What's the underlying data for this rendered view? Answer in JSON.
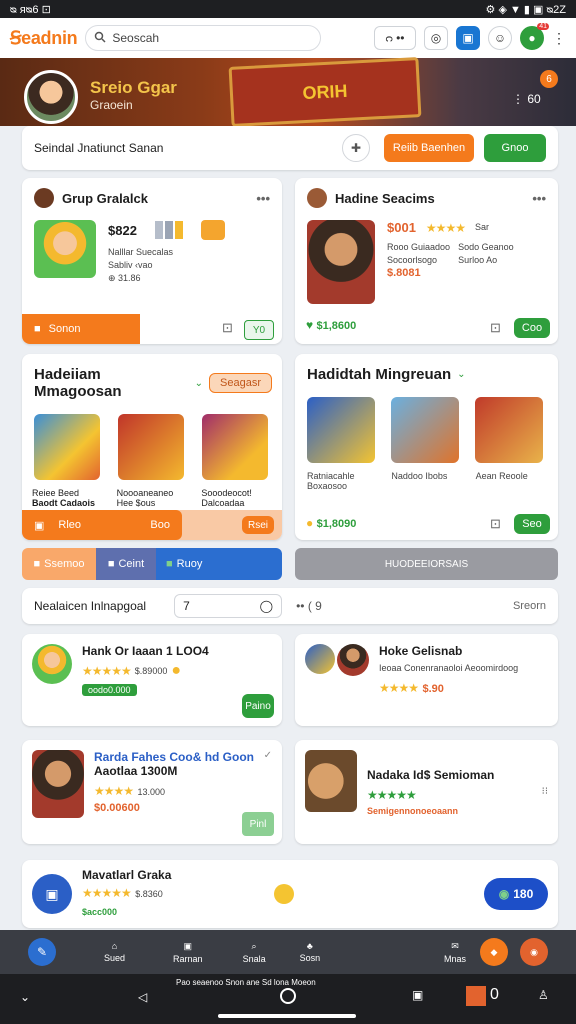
{
  "status": {
    "left": "ᴓ ᴙᴓ6 ⊡",
    "right": "⚙ ◈ ▼ ▮ ▣ ᴓ2Z"
  },
  "appbar": {
    "brand": "Ꞩeadnin",
    "search_placeholder": "Seoscah",
    "icons": [
      "ᴒ ••",
      "◎",
      "▣",
      "☺",
      "●"
    ],
    "badge": "41"
  },
  "banner": {
    "title": "Sreio Ggar",
    "subtitle": "Graoein",
    "art_text": "ORIH",
    "badge": "6",
    "right_text": "⋮ 60"
  },
  "namebar": {
    "text": "Seindal Jnatiunct Sanan",
    "orange_button": "Reiib Baenhen",
    "green_button": "Gnoo"
  },
  "card1": {
    "title": "Grup  Gralalck",
    "price": "$822",
    "meta1": "Nalllar Suecalas",
    "meta2": "Sabliv ‹vao",
    "meta3": "⊕ 31.86",
    "bottom_label": "Sonon",
    "bottom_btn": "Y0"
  },
  "card2": {
    "title": "Hadine Seacims",
    "price": "$001",
    "meta1": "Rooo Guiaadoo",
    "meta2": "Socoorlsogo",
    "price2": "$.8081",
    "rating_text": "Sar",
    "meta3": "Sodo Geanoo",
    "meta4": "Surloo Ao",
    "bottom_value": "$1,8600",
    "bottom_btn": "Coo"
  },
  "section1": {
    "title": "Hadeiiam Mmagoosan",
    "pill": "Seagasr",
    "items": [
      {
        "label": "Reiee Beed",
        "sub": "Baodt Cadaois"
      },
      {
        "label": "Noooaneaneo",
        "sub": "Hee $ous"
      },
      {
        "label": "Sooodeocot!",
        "sub": "Dalcoadaa"
      }
    ],
    "bar_left": "Rleo",
    "bar_mid": "Boo",
    "bar_btn": "Rsei"
  },
  "section2": {
    "title": "Hadidtah Mingreuan",
    "items": [
      {
        "label": "Ratniacahle",
        "sub": "Boxaosoo"
      },
      {
        "label": "Naddoo Ibobs"
      },
      {
        "label": "Aean Reoole"
      }
    ],
    "bottom_value": "$1,8090",
    "bottom_btn": "Seo"
  },
  "tabs": [
    "Ssemoo",
    "Ceint",
    "Ruoy"
  ],
  "grey_bar": "HUODEEIORSAIS",
  "filter": {
    "label": "Nealaicen Inlnapgoal",
    "input_value": "7",
    "extra": "•• ( 9",
    "right": "Sreorn"
  },
  "list": [
    {
      "title": "Hank Or Iaaan 1 LOO4",
      "rating": "$.89000",
      "tag": "oodo0.000",
      "btn": "Paino"
    },
    {
      "title": "Hoke Gelisnab",
      "sub": "Ieoaa Conenranaoloi Aeoomirdoog",
      "rating": "$.90"
    },
    {
      "title": "Rarda Fahes Coo& hd Goon",
      "subtitle": "Aaotlaa 1300M",
      "rating": "13.000",
      "price": "$0.00600",
      "btn": "Pinl"
    },
    {
      "title": "Nadaka Id$ Semioman",
      "sub": "Semigennonoeoaann"
    },
    {
      "title": "Mavatlarl Graka",
      "rating": "$.8360",
      "tag": "$acc000",
      "btn": "180"
    }
  ],
  "bottomnav": [
    "Sued",
    "Rarnan",
    "Snala",
    "Sosn",
    "Mnas"
  ],
  "sysbar": {
    "center": "Pao seaenoo Snon ane Sd lona Moeon"
  },
  "colors": {
    "orange": "#f47a1c",
    "green": "#2e9e3c",
    "blue": "#1976d2"
  }
}
